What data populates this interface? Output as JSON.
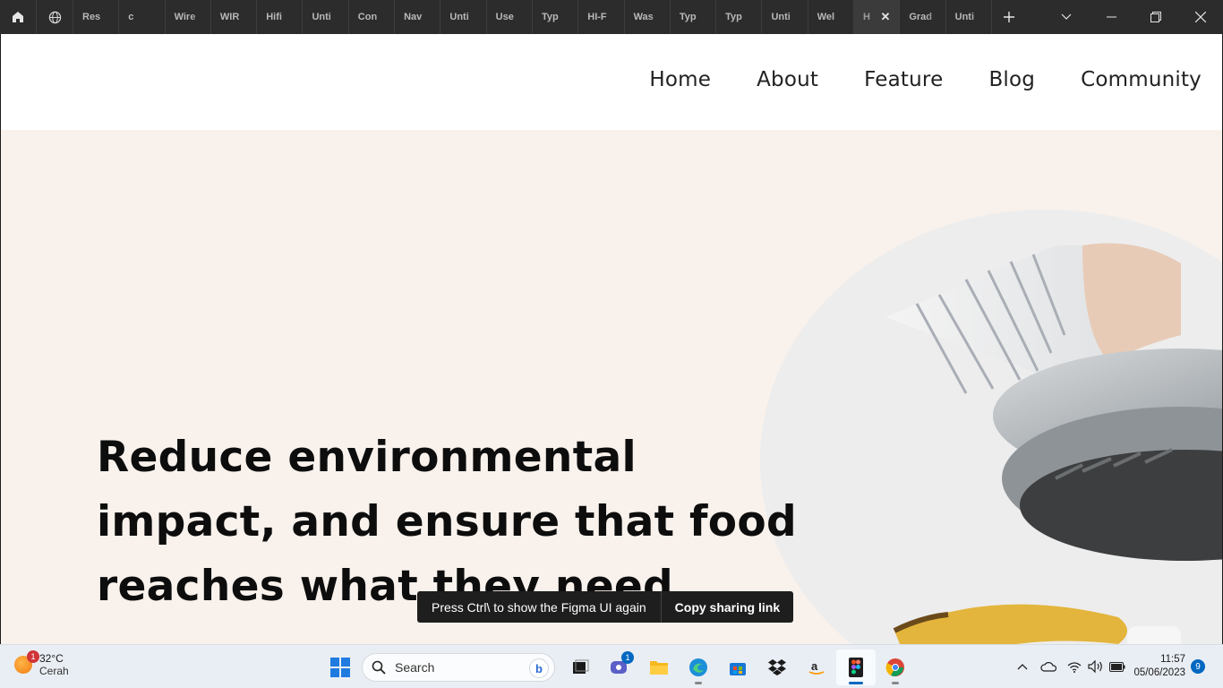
{
  "browser_tabs": [
    {
      "label": "Res"
    },
    {
      "label": "c"
    },
    {
      "label": "Wire"
    },
    {
      "label": "WIR"
    },
    {
      "label": "Hifi"
    },
    {
      "label": "Unti"
    },
    {
      "label": "Con"
    },
    {
      "label": "Nav"
    },
    {
      "label": "Unti"
    },
    {
      "label": "Use"
    },
    {
      "label": "Typ"
    },
    {
      "label": "HI-F"
    },
    {
      "label": "Was"
    },
    {
      "label": "Typ"
    },
    {
      "label": "Typ"
    },
    {
      "label": "Unti"
    },
    {
      "label": "Wel"
    },
    {
      "label": "H"
    },
    {
      "label": "Grad"
    },
    {
      "label": "Unti"
    }
  ],
  "active_tab_index": 17,
  "site": {
    "nav": [
      "Home",
      "About",
      "Feature",
      "Blog",
      "Community"
    ],
    "headline": "Reduce environmental impact, and ensure that food reaches what they need"
  },
  "toast": {
    "message": "Press Ctrl\\ to show the Figma UI again",
    "action": "Copy sharing link"
  },
  "taskbar": {
    "weather": {
      "temp": "32°C",
      "condition": "Cerah",
      "badge": "1"
    },
    "search_placeholder": "Search",
    "teams_badge": "1",
    "time": "11:57",
    "date": "05/06/2023",
    "notifications": "9"
  },
  "colors": {
    "tabbar_bg": "#2c2c2c",
    "page_bg": "#f8f1ec",
    "header_bg": "#ffffff",
    "headline": "#0d0d0d",
    "toast_bg": "#1e1e1e",
    "taskbar_bg": "#e9eef4",
    "accent": "#0067c0"
  }
}
